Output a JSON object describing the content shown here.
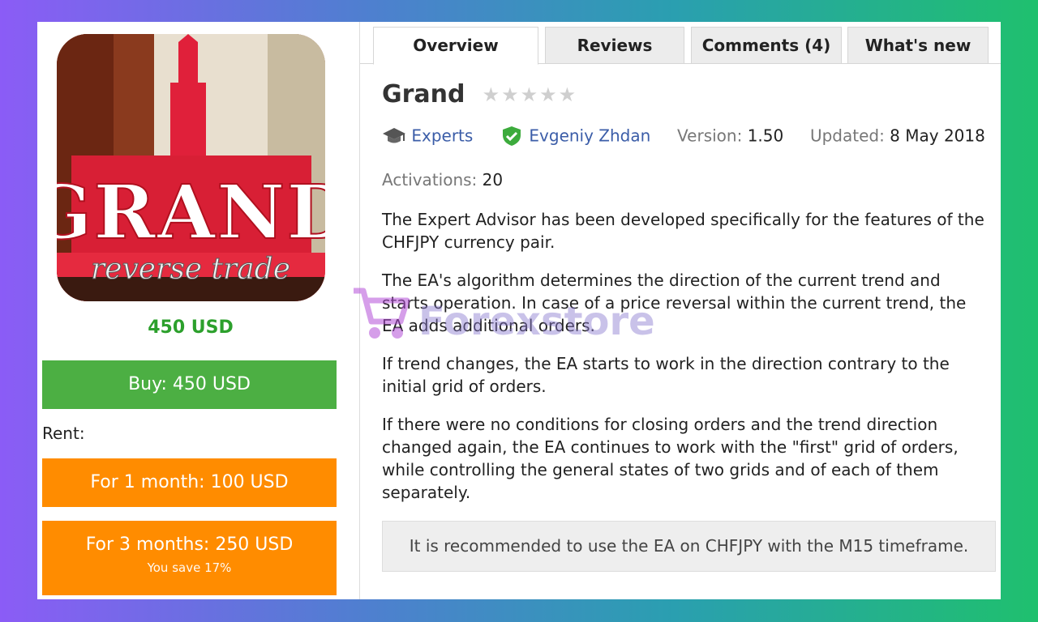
{
  "product": {
    "image_alt_text": "GRAND reverse trade",
    "image_title": "GRAND",
    "image_subtitle": "reverse trade",
    "price": "450 USD",
    "buy_label": "Buy: 450 USD",
    "rent_label": "Rent:",
    "rent_1_month": "For 1 month: 100 USD",
    "rent_3_months": "For 3 months: 250 USD",
    "rent_3_months_saving": "You save 17%"
  },
  "tabs": [
    {
      "label": "Overview",
      "active": true
    },
    {
      "label": "Reviews",
      "active": false
    },
    {
      "label": "Comments (4)",
      "active": false
    },
    {
      "label": "What's new",
      "active": false
    }
  ],
  "details": {
    "title": "Grand",
    "rating_stars": 0,
    "rating_max": 5,
    "category": "Experts",
    "author": "Evgeniy Zhdan",
    "version_label": "Version:",
    "version": "1.50",
    "updated_label": "Updated:",
    "updated": "8 May 2018",
    "activations_label": "Activations:",
    "activations": "20"
  },
  "description": [
    "The Expert Advisor has been developed specifically for the features of the CHFJPY currency pair.",
    "The EA's algorithm determines the direction of the current trend and starts operation. In case of a price reversal within the current trend, the EA adds additional orders.",
    "If trend changes, the EA starts to work in the direction contrary to the initial grid of orders.",
    "If there were no conditions for closing orders and the trend direction changed again, the EA continues to work with the \"first\" grid of orders, while controlling the general states of two grids and of each of them separately."
  ],
  "recommendation": "It is recommended to use the EA on CHFJPY with the M15 timeframe.",
  "watermark_text": "Forexstore",
  "colors": {
    "buy_green": "#4caf43",
    "rent_orange": "#ff8c00",
    "price_green": "#2ca02c",
    "link_blue": "#3b5da8"
  },
  "icons": [
    "graduation-cap-icon",
    "verified-shield-icon",
    "star-icon",
    "shopping-cart-icon"
  ]
}
